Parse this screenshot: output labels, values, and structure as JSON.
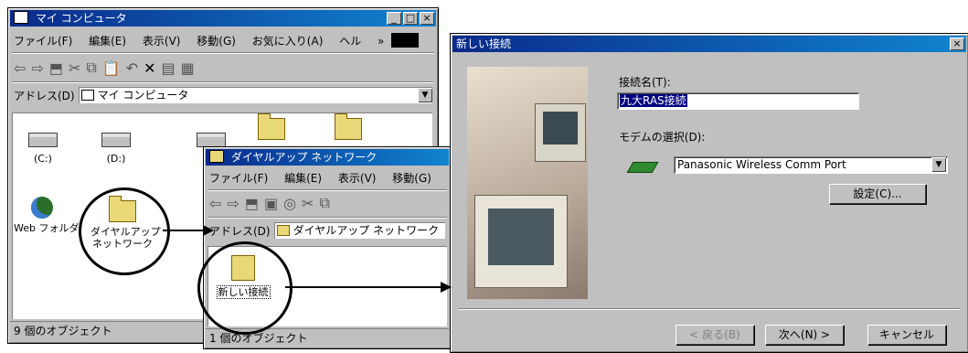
{
  "mycomputer": {
    "title": "マイ コンピュータ",
    "menu": [
      "ファイル(F)",
      "編集(E)",
      "表示(V)",
      "移動(G)",
      "お気に入り(A)",
      "ヘル"
    ],
    "menu_more": "»",
    "address_label": "アドレス(D)",
    "address_value": "マイ コンピュータ",
    "items": {
      "drive_c": "(C:)",
      "drive_d": "(D:)",
      "web_folder": "Web フォルダ",
      "dialup_line1": "ダイヤルアップ",
      "dialup_line2": "ネットワーク"
    },
    "status": "9 個のオブジェクト"
  },
  "dialup": {
    "title": "ダイヤルアップ ネットワーク",
    "menu": [
      "ファイル(F)",
      "編集(E)",
      "表示(V)",
      "移動(G)"
    ],
    "address_label": "アドレス(D)",
    "address_value": "ダイヤルアップ ネットワーク",
    "new_connection_label": "新しい接続",
    "status": "1 個のオブジェクト"
  },
  "wizard": {
    "title": "新しい接続",
    "conn_name_label": "接続名(T):",
    "conn_name_value": "九大RAS接続",
    "modem_label": "モデムの選択(D):",
    "modem_value": "Panasonic Wireless Comm Port",
    "settings_button": "設定(C)...",
    "back_button": "< 戻る(B)",
    "next_button": "次へ(N) >",
    "cancel_button": "キャンセル"
  }
}
